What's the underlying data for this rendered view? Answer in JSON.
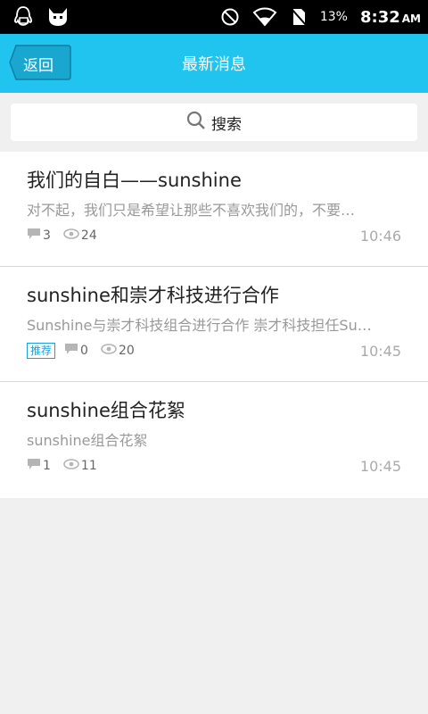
{
  "status_bar": {
    "battery": "13%",
    "time": "8:32",
    "ampm": "AM"
  },
  "header": {
    "back_label": "返回",
    "title": "最新消息"
  },
  "search": {
    "label": "搜索"
  },
  "items": [
    {
      "title": "我们的自白——sunshine",
      "summary": "对不起，我们只是希望让那些不喜欢我们的，不要…",
      "tag": "",
      "comments": "3",
      "views": "24",
      "time": "10:46"
    },
    {
      "title": "sunshine和崇才科技进行合作",
      "summary": "Sunshine与崇才科技组合进行合作 崇才科技担任Su…",
      "tag": "推荐",
      "comments": "0",
      "views": "20",
      "time": "10:45"
    },
    {
      "title": "sunshine组合花絮",
      "summary": "sunshine组合花絮",
      "tag": "",
      "comments": "1",
      "views": "11",
      "time": "10:45"
    }
  ],
  "colors": {
    "header_bg": "#20c4ee",
    "tag": "#1e9fd7"
  }
}
